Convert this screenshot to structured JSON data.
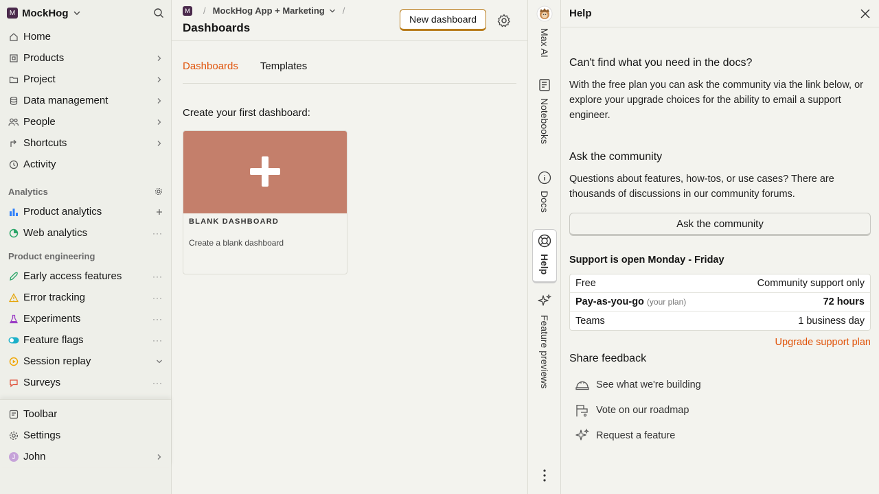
{
  "sidebar": {
    "org_badge": "M",
    "org_name": "MockHog",
    "nav": [
      {
        "label": "Home",
        "icon": "home-icon"
      },
      {
        "label": "Products",
        "icon": "products-icon"
      },
      {
        "label": "Project",
        "icon": "folder-icon"
      },
      {
        "label": "Data management",
        "icon": "database-icon"
      },
      {
        "label": "People",
        "icon": "people-icon"
      },
      {
        "label": "Shortcuts",
        "icon": "shortcut-icon"
      },
      {
        "label": "Activity",
        "icon": "clock-icon"
      }
    ],
    "analytics_title": "Analytics",
    "analytics": [
      {
        "label": "Product analytics",
        "icon": "bar-chart-icon"
      },
      {
        "label": "Web analytics",
        "icon": "web-analytics-icon"
      }
    ],
    "engineering_title": "Product engineering",
    "engineering": [
      {
        "label": "Early access features",
        "icon": "rocket-icon"
      },
      {
        "label": "Error tracking",
        "icon": "warning-icon"
      },
      {
        "label": "Experiments",
        "icon": "flask-icon"
      },
      {
        "label": "Feature flags",
        "icon": "toggle-icon"
      },
      {
        "label": "Session replay",
        "icon": "replay-icon"
      },
      {
        "label": "Surveys",
        "icon": "chat-icon"
      }
    ],
    "bottom": [
      {
        "label": "Toolbar",
        "icon": "toolbar-icon"
      },
      {
        "label": "Settings",
        "icon": "gear-icon"
      },
      {
        "label": "John",
        "icon": "avatar",
        "avatar_letter": "J"
      }
    ]
  },
  "main": {
    "breadcrumb_badge": "M",
    "breadcrumb_project": "MockHog App + Marketing",
    "page_title": "Dashboards",
    "new_dashboard_label": "New dashboard",
    "tabs": [
      {
        "label": "Dashboards",
        "active": true
      },
      {
        "label": "Templates",
        "active": false
      }
    ],
    "create_label": "Create your first dashboard:",
    "card": {
      "title": "BLANK DASHBOARD",
      "description": "Create a blank dashboard"
    }
  },
  "rail": {
    "items": [
      {
        "label": "Max AI",
        "icon": "hedgehog-avatar-icon"
      },
      {
        "label": "Notebooks",
        "icon": "notebook-icon"
      },
      {
        "label": "Docs",
        "icon": "info-icon"
      },
      {
        "label": "Help",
        "icon": "lifebuoy-icon",
        "active": true
      },
      {
        "label": "Feature previews",
        "icon": "sparkle-icon"
      }
    ]
  },
  "help": {
    "title": "Help",
    "docs_heading": "Can't find what you need in the docs?",
    "docs_text": "With the free plan you can ask the community via the link below, or explore your upgrade choices for the ability to email a support engineer.",
    "community_heading": "Ask the community",
    "community_text": "Questions about features, how-tos, or use cases? There are thousands of discussions in our community forums.",
    "community_button": "Ask the community",
    "support_heading": "Support is open Monday - Friday",
    "support_rows": [
      {
        "plan": "Free",
        "note": "",
        "value": "Community support only",
        "bold": false
      },
      {
        "plan": "Pay-as-you-go",
        "note": "(your plan)",
        "value": "72 hours",
        "bold": true
      },
      {
        "plan": "Teams",
        "note": "",
        "value": "1 business day",
        "bold": false
      }
    ],
    "upgrade_link": "Upgrade support plan",
    "feedback_heading": "Share feedback",
    "feedback_items": [
      {
        "label": "See what we're building",
        "icon": "helmet-icon"
      },
      {
        "label": "Vote on our roadmap",
        "icon": "roadmap-icon"
      },
      {
        "label": "Request a feature",
        "icon": "sparkle-icon"
      }
    ]
  },
  "colors": {
    "accent": "#e0540b",
    "card_bg": "#c47f6b",
    "button_border": "#b77b1a",
    "project_badge": "#4b2a4c"
  }
}
